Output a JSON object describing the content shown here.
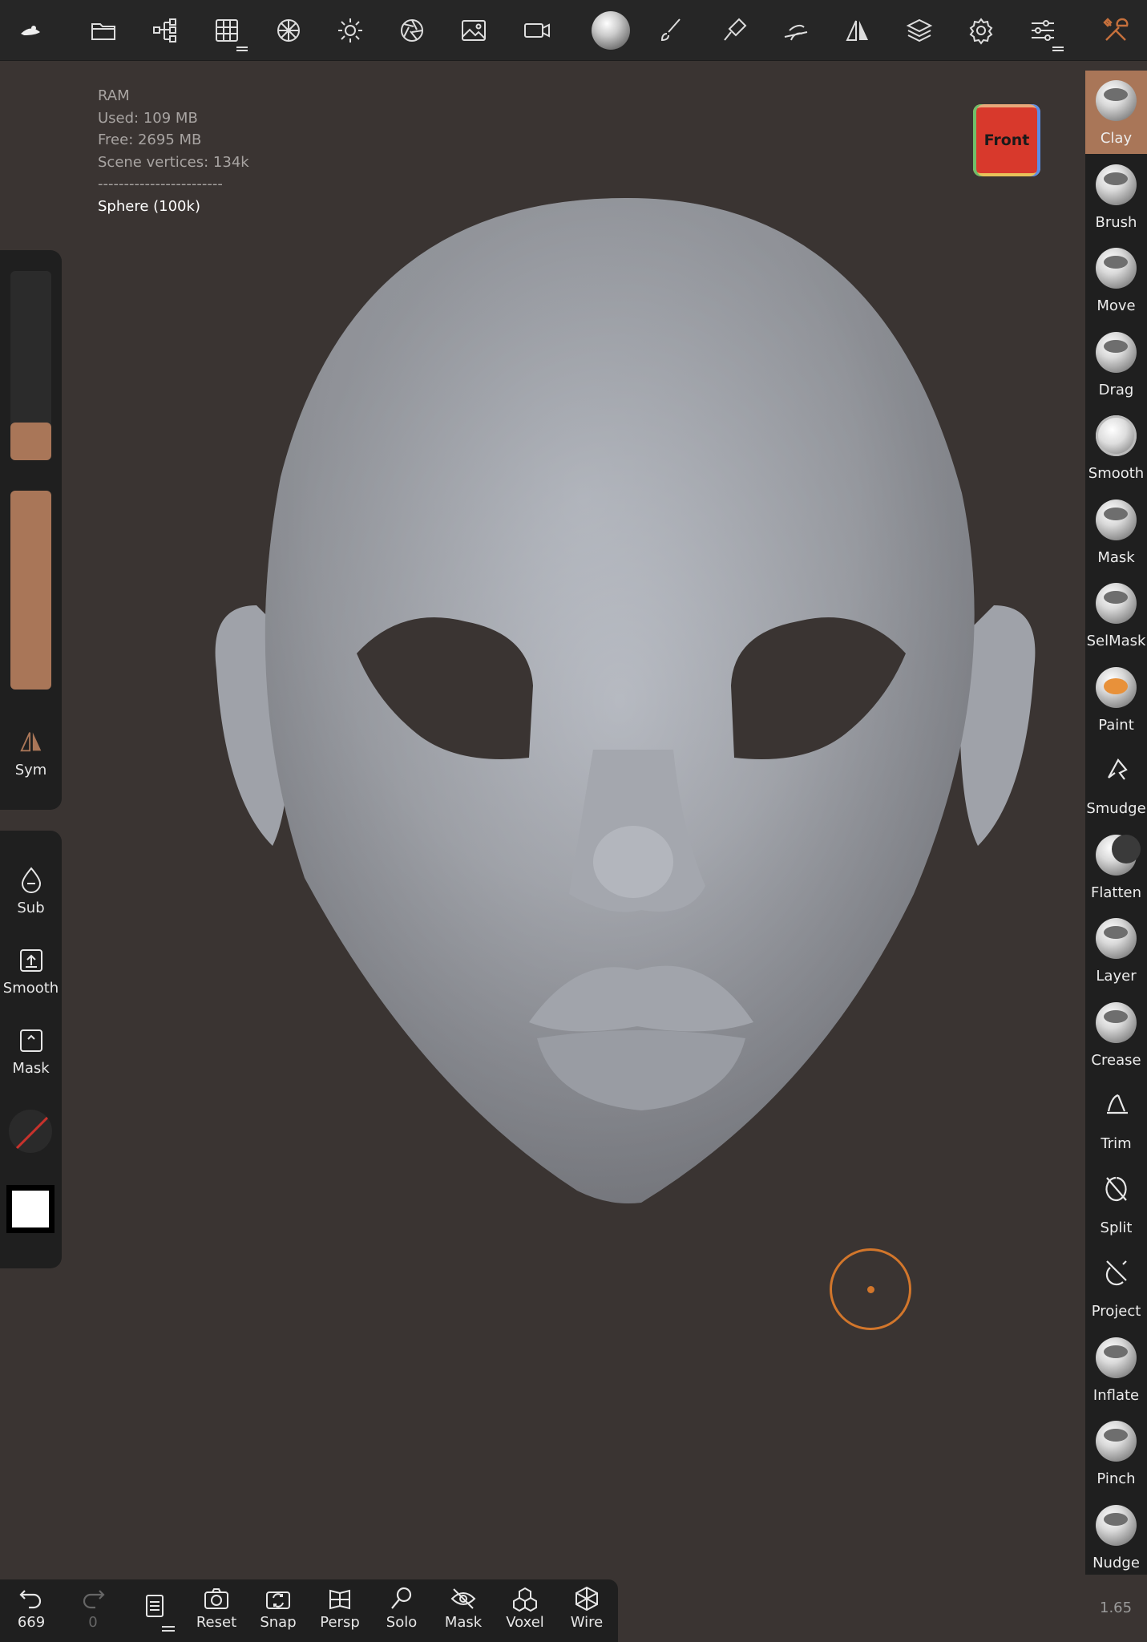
{
  "toolbar": {
    "icons": [
      "logo-icon",
      "folder-icon",
      "scene-tree-icon",
      "grid-icon",
      "topology-icon",
      "lighting-icon",
      "camera-aperture-icon",
      "background-image-icon",
      "video-icon",
      "material-icon",
      "paint-brush-icon",
      "stroke-icon",
      "gizmo-icon",
      "symmetry-icon",
      "layers-icon",
      "settings-icon",
      "sliders-icon",
      "tools-icon"
    ]
  },
  "stats": {
    "ram_label": "RAM",
    "used": "Used: 109 MB",
    "free": "Free: 2695 MB",
    "scene_vertices": "Scene vertices: 134k",
    "separator": "------------------------",
    "selected_object": "Sphere (100k)"
  },
  "view_cube": {
    "face": "Front"
  },
  "left_panel": {
    "radius_level": 0.2,
    "intensity_level": 1.0,
    "sym_label": "Sym",
    "sub_label": "Sub",
    "smooth_label": "Smooth",
    "mask_label": "Mask"
  },
  "brushes": [
    {
      "label": "Clay",
      "active": true
    },
    {
      "label": "Brush",
      "active": false
    },
    {
      "label": "Move",
      "active": false
    },
    {
      "label": "Drag",
      "active": false
    },
    {
      "label": "Smooth",
      "active": false
    },
    {
      "label": "Mask",
      "active": false
    },
    {
      "label": "SelMask",
      "active": false
    },
    {
      "label": "Paint",
      "active": false
    },
    {
      "label": "Smudge",
      "active": false
    },
    {
      "label": "Flatten",
      "active": false
    },
    {
      "label": "Layer",
      "active": false
    },
    {
      "label": "Crease",
      "active": false
    },
    {
      "label": "Trim",
      "active": false
    },
    {
      "label": "Split",
      "active": false
    },
    {
      "label": "Project",
      "active": false
    },
    {
      "label": "Inflate",
      "active": false
    },
    {
      "label": "Pinch",
      "active": false
    },
    {
      "label": "Nudge",
      "active": false
    }
  ],
  "bottom_bar": {
    "undo_count": "669",
    "redo_count": "0",
    "reset": "Reset",
    "snap": "Snap",
    "persp": "Persp",
    "solo": "Solo",
    "mask": "Mask",
    "voxel": "Voxel",
    "wire": "Wire"
  },
  "zoom": "1.65",
  "colors": {
    "accent": "#a97658",
    "panel": "#1f1f1f",
    "background": "#3a3432",
    "cursor": "#d2762b"
  }
}
